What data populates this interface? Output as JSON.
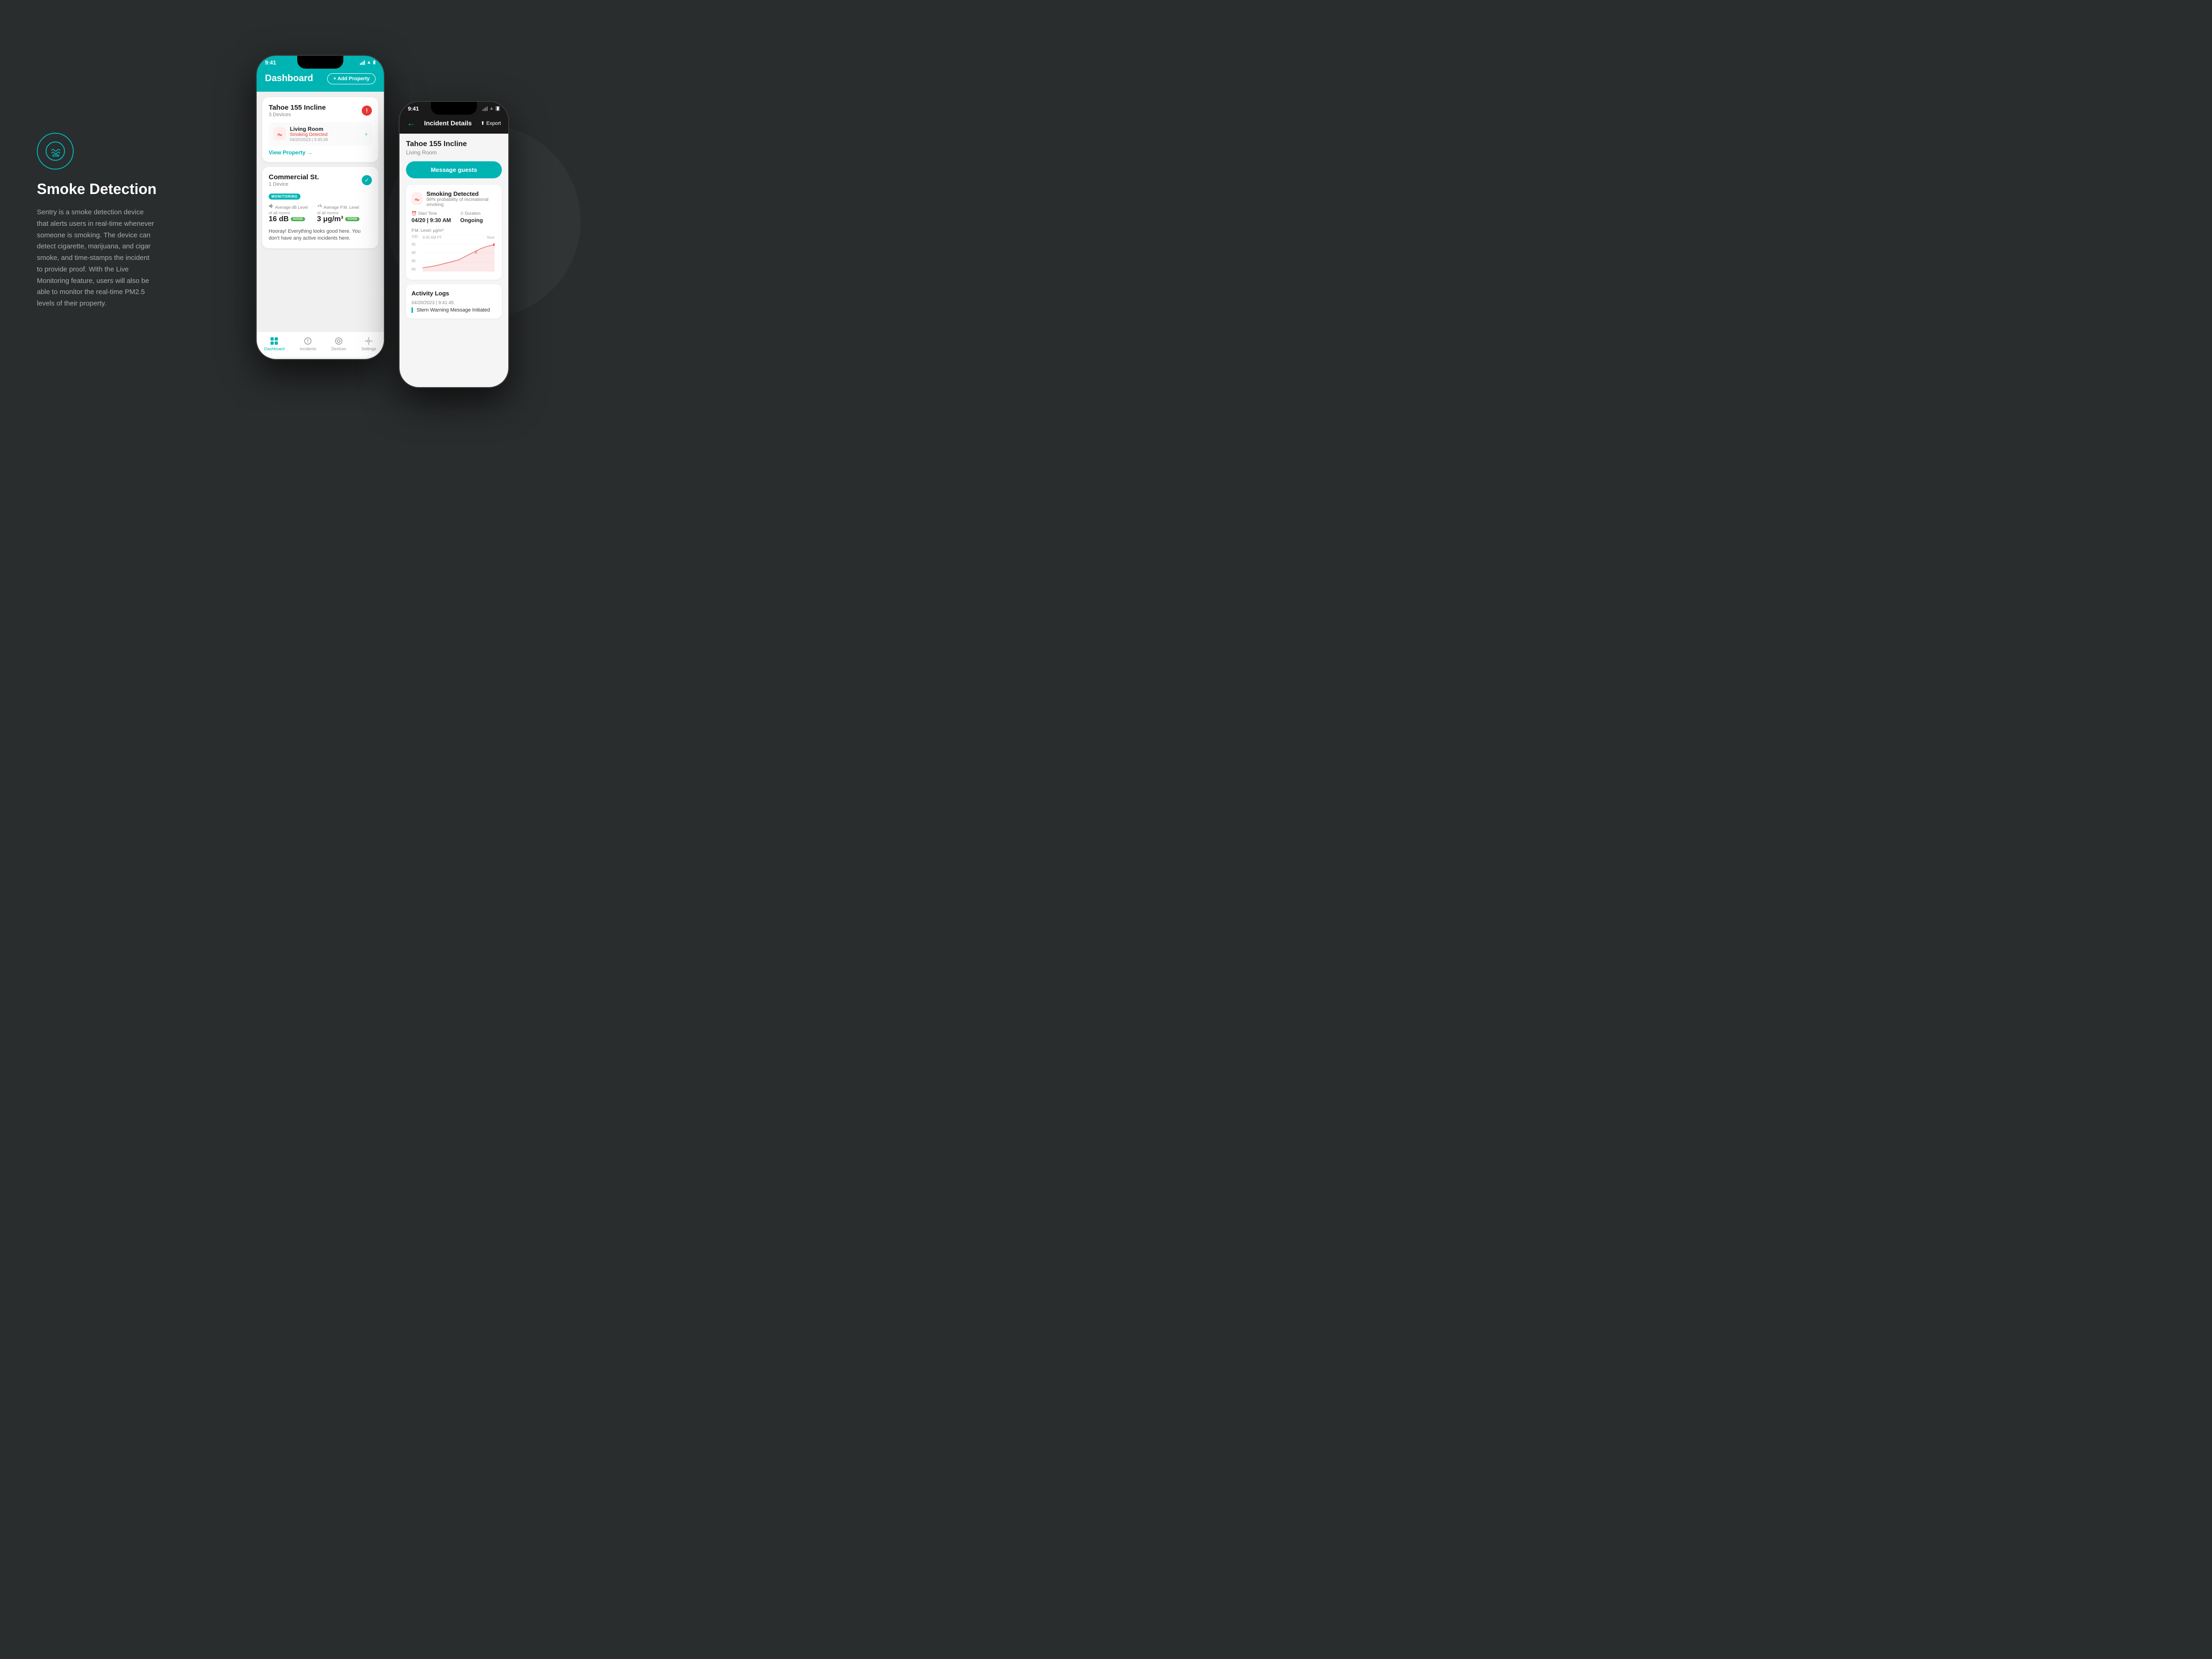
{
  "background": "#2a2d2e",
  "left": {
    "icon_label": "smoke-detection-icon",
    "title": "Smoke Detection",
    "description": "Sentry is a smoke detection device that alerts users in real-time whenever someone is smoking. The device can detect cigarette, marijuana, and cigar smoke, and time-stamps the incident to provide proof. With the Live Monitoring feature, users will also be able to monitor the real-time PM2.5 levels of their property."
  },
  "phone_main": {
    "status_bar": {
      "time": "9:41",
      "battery": "▮",
      "signal": "●●●"
    },
    "header": {
      "title": "Dashboard",
      "add_button": "+ Add Property"
    },
    "cards": [
      {
        "id": "tahoe-card",
        "property_name": "Tahoe 155 Incline",
        "devices_count": "3 Devices",
        "has_alert": true,
        "device": {
          "name": "Living Room",
          "status": "Smoking Detected",
          "date": "04/20/2023 | 9:30:39"
        },
        "view_link": "View Property →"
      },
      {
        "id": "commercial-card",
        "property_name": "Commercial St.",
        "devices_count": "1 Device",
        "has_alert": false,
        "has_check": true,
        "has_monitoring": true,
        "monitoring_label": "MONITORING",
        "avg_db_label": "Average dB Level",
        "avg_db_sublabel": "of all rooms",
        "avg_db_value": "16 dB",
        "avg_db_status": "GOOD",
        "avg_pm_label": "Average P.M. Level",
        "avg_pm_sublabel": "of all rooms",
        "avg_pm_value": "3 μg/m³",
        "avg_pm_status": "GOOD",
        "hooray_text": "Hooray! Everything looks good here. You don't have any active incidents here."
      }
    ],
    "bottom_nav": [
      {
        "label": "Dashboard",
        "active": true,
        "icon": "dashboard"
      },
      {
        "label": "Incidents",
        "active": false,
        "icon": "incidents"
      },
      {
        "label": "Devices",
        "active": false,
        "icon": "devices"
      },
      {
        "label": "Settings",
        "active": false,
        "icon": "settings"
      }
    ]
  },
  "phone_secondary": {
    "status_bar": {
      "time": "9:41"
    },
    "header": {
      "back_label": "←",
      "title": "Incident Details",
      "export_label": "⬆ Export"
    },
    "property": "Tahoe 155 Incline",
    "room": "Living Room",
    "message_btn": "Message guests",
    "smoking_card": {
      "title": "Smoking Detected",
      "probability": "99% probability of recreational smoking",
      "start_time_label": "Start Time",
      "start_time_value": "04/20 | 9:30 AM",
      "duration_label": "Duration",
      "duration_value": "Ongoing"
    },
    "chart": {
      "title": "P.M. Level: μg/m³",
      "y_labels": [
        "100",
        "95",
        "90",
        "85",
        "80"
      ],
      "x_labels": [
        "9:30 AM\nPT",
        "Now"
      ]
    },
    "activity_logs": {
      "title": "Activity Logs",
      "date": "04/20/2023 | 9:41:45",
      "item": "Stern Warning Message Initiated"
    }
  }
}
